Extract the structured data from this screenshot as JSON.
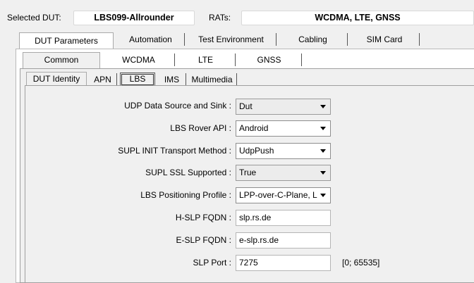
{
  "header": {
    "selected_dut_label": "Selected DUT:",
    "selected_dut_value": "LBS099-Allrounder",
    "rats_label": "RATs:",
    "rats_value": "WCDMA, LTE, GNSS"
  },
  "main_tabs": [
    "DUT Parameters",
    "Automation",
    "Test Environment",
    "Cabling",
    "SIM Card"
  ],
  "rat_tabs": [
    "Common",
    "WCDMA",
    "LTE",
    "GNSS"
  ],
  "sub_tabs": [
    "DUT Identity",
    "APN",
    "LBS",
    "IMS",
    "Multimedia"
  ],
  "form": {
    "udp_source_sink": {
      "label": "UDP Data Source and Sink :",
      "value": "Dut"
    },
    "lbs_rover_api": {
      "label": "LBS Rover API :",
      "value": "Android"
    },
    "supl_init_transport": {
      "label": "SUPL INIT Transport Method :",
      "value": "UdpPush"
    },
    "supl_ssl": {
      "label": "SUPL SSL Supported :",
      "value": "True"
    },
    "lbs_positioning_profile": {
      "label": "LBS Positioning Profile :",
      "value": "LPP-over-C-Plane, L"
    },
    "h_slp_fqdn": {
      "label": "H-SLP FQDN :",
      "value": "slp.rs.de"
    },
    "e_slp_fqdn": {
      "label": "E-SLP FQDN :",
      "value": "e-slp.rs.de"
    },
    "slp_port": {
      "label": "SLP Port :",
      "value": "7275",
      "range": "[0; 65535]"
    }
  }
}
